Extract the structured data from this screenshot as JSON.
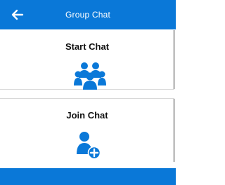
{
  "header": {
    "title": "Group Chat",
    "back_icon": "arrow-left-icon"
  },
  "cards": {
    "start_chat": {
      "label": "Start Chat",
      "icon": "group-icon"
    },
    "join_chat": {
      "label": "Join Chat",
      "icon": "user-add-icon"
    }
  },
  "colors": {
    "primary": "#0a78d8",
    "text": "#111111",
    "background": "#ffffff"
  }
}
